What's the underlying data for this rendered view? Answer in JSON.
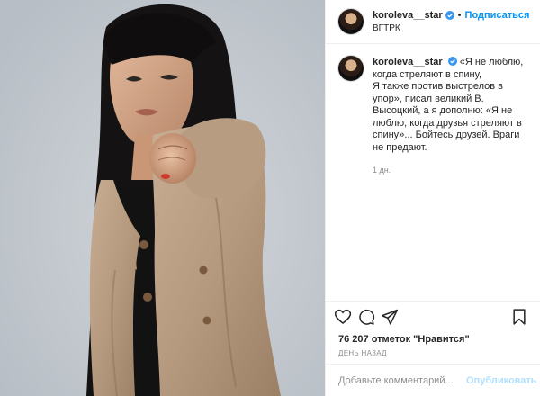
{
  "header": {
    "username": "koroleva__star",
    "separator": "•",
    "follow_label": "Подписаться",
    "location": "ВГТРК"
  },
  "caption": {
    "username": "koroleva__star",
    "text": "«Я не люблю, когда стреляют в спину,\nЯ также против выстрелов в упор», писал великий В. Высоцкий, а я дополню: «Я не люблю, когда друзья стреляют в спину»... Бойтесь друзей. Враги не предают.",
    "time": "1 дн."
  },
  "actions": {
    "like_icon": "heart-icon",
    "comment_icon": "comment-icon",
    "share_icon": "share-icon",
    "save_icon": "bookmark-icon"
  },
  "likes_text": "76 207 отметок \"Нравится\"",
  "date_text": "ДЕНЬ НАЗАД",
  "comment_box": {
    "placeholder": "Добавьте комментарий...",
    "publish_label": "Опубликовать"
  },
  "colors": {
    "accent": "#0095f6",
    "publish_disabled": "#b2dffc",
    "verified": "#3897f0",
    "muted": "#8e8e8e"
  }
}
